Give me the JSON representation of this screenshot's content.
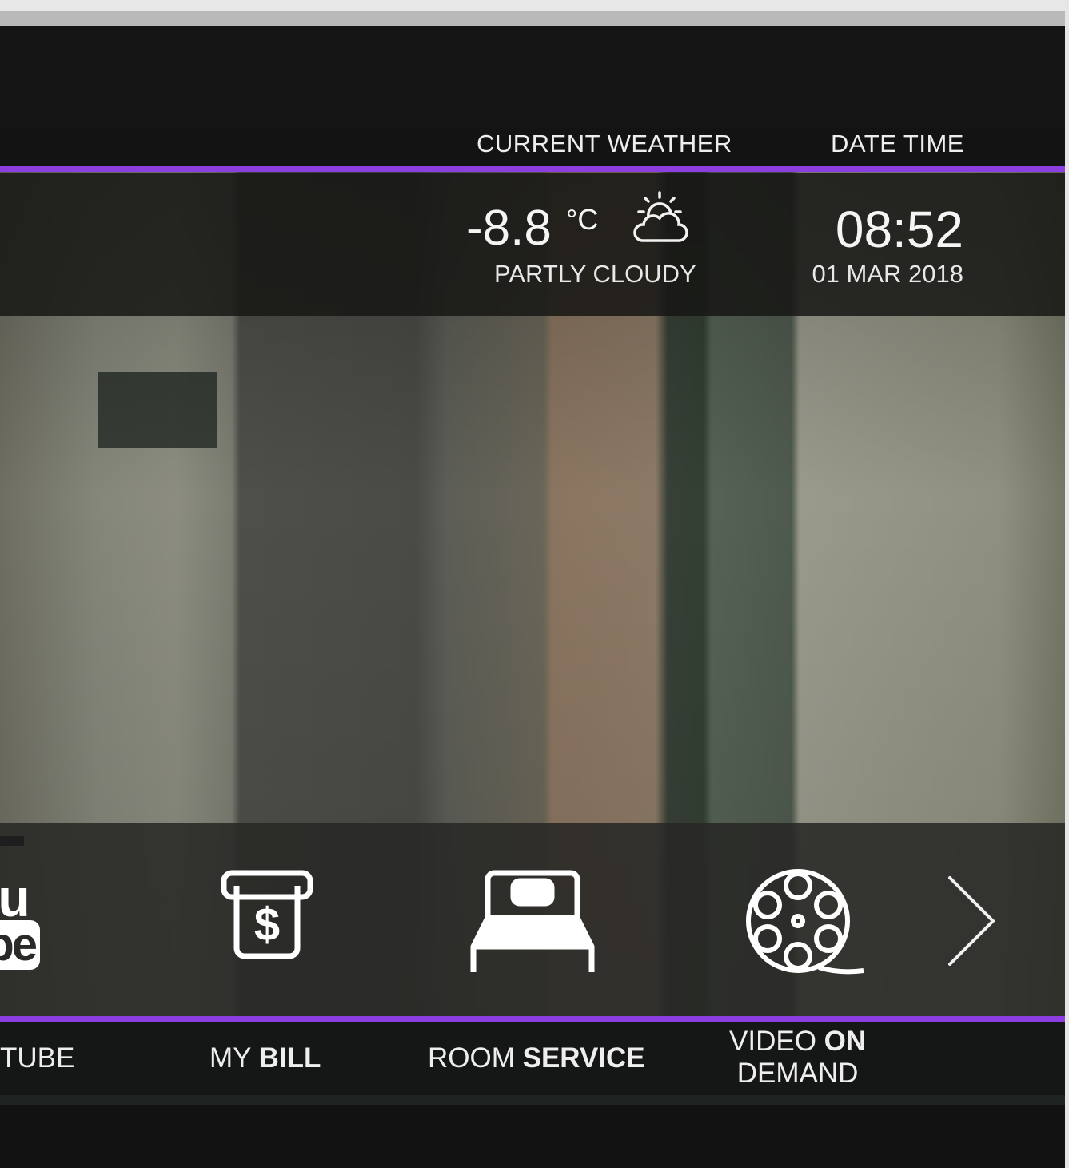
{
  "header": {
    "weather_label": "CURRENT WEATHER",
    "datetime_label": "DATE TIME"
  },
  "weather": {
    "temperature": "-8.8",
    "unit": "°C",
    "condition": "PARTLY CLOUDY",
    "icon": "partly-cloudy-icon"
  },
  "datetime": {
    "time": "08:52",
    "date": "01 MAR 2018"
  },
  "menu": {
    "youtube": {
      "logo_you": "ou",
      "logo_tube": "be",
      "label": "TUBE",
      "icon": "youtube-logo"
    },
    "my_bill": {
      "label_light": "MY ",
      "label_bold": "BILL",
      "icon": "bill-icon"
    },
    "room_service": {
      "label_light": "ROOM ",
      "label_bold": "SERVICE",
      "icon": "bed-icon"
    },
    "vod": {
      "label_light": "VIDEO ",
      "label_bold": "ON",
      "label_line2": "DEMAND",
      "icon": "film-reel-icon"
    },
    "next": {
      "icon": "chevron-right-icon"
    }
  },
  "colors": {
    "accent": "#8d3ee0",
    "background": "#121212"
  }
}
